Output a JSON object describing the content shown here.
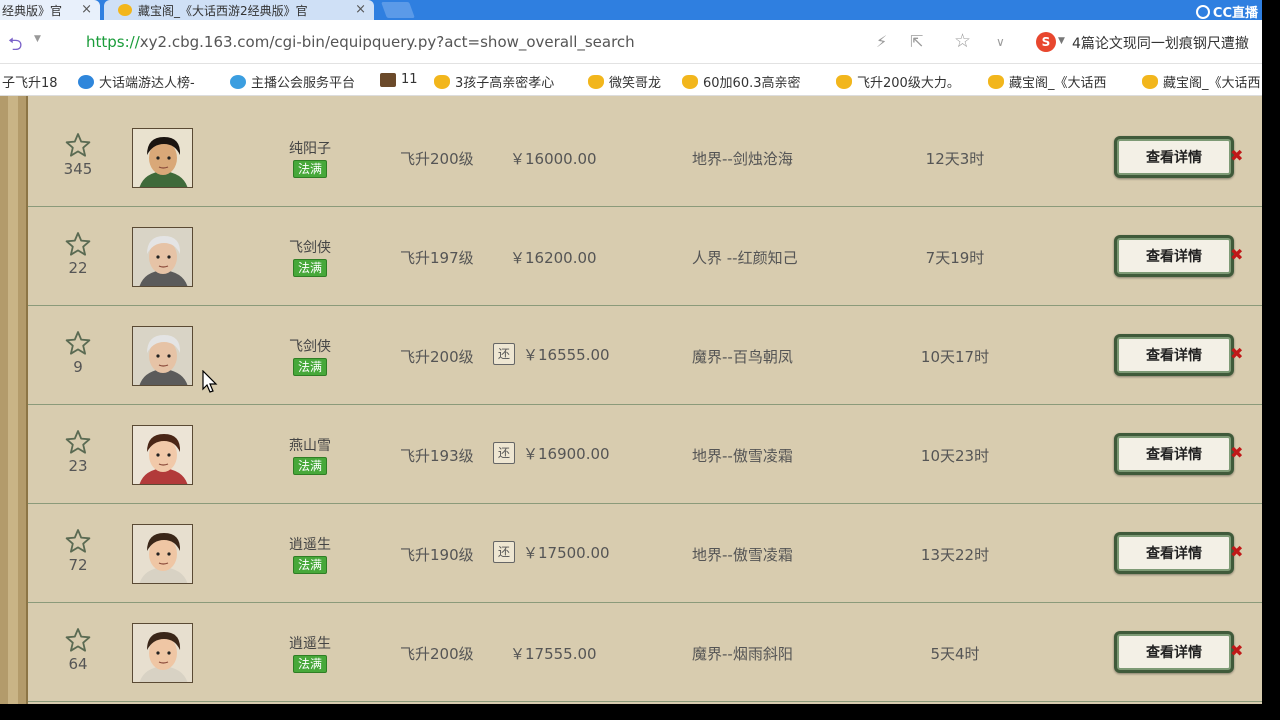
{
  "tabs": [
    {
      "label": "经典版》官",
      "close": "×"
    },
    {
      "label": "藏宝阁_《大话西游2经典版》官",
      "close": "×"
    }
  ],
  "brand": "CC直播",
  "address": {
    "scheme": "https://",
    "rest": "xy2.cbg.163.com/cgi-bin/equipquery.py?act=show_overall_search"
  },
  "search_box": {
    "text": "4篇论文现同一划痕钢尺遭撤"
  },
  "bookmarks": [
    {
      "label": "子飞升18",
      "icon": "none"
    },
    {
      "label": "大话端游达人榜-",
      "icon": "blue"
    },
    {
      "label": "主播公会服务平台",
      "icon": "globe"
    },
    {
      "label": "11",
      "icon": "game"
    },
    {
      "label": "3孩子高亲密孝心",
      "icon": "star"
    },
    {
      "label": "微笑哥龙",
      "icon": "star"
    },
    {
      "label": "60加60.3高亲密",
      "icon": "star"
    },
    {
      "label": "飞升200级大力。",
      "icon": "star"
    },
    {
      "label": "藏宝阁_《大话西",
      "icon": "star"
    },
    {
      "label": "藏宝阁_《大话西",
      "icon": "star"
    }
  ],
  "listings": [
    {
      "fav": "345",
      "avatar": "male-dark",
      "name": "纯阳子",
      "school": "法满",
      "level": "飞升200级",
      "returnable": false,
      "price": "￥16000.00",
      "server": "地界--剑烛沧海",
      "time": "12天3时",
      "button": "查看详情"
    },
    {
      "fav": "22",
      "avatar": "male-white",
      "name": "飞剑侠",
      "school": "法满",
      "level": "飞升197级",
      "returnable": false,
      "price": "￥16200.00",
      "server": "人界 --红颜知己",
      "time": "7天19时",
      "button": "查看详情"
    },
    {
      "fav": "9",
      "avatar": "male-white",
      "name": "飞剑侠",
      "school": "法满",
      "level": "飞升200级",
      "returnable": true,
      "return_label": "还",
      "price": "￥16555.00",
      "server": "魔界--百鸟朝凤",
      "time": "10天17时",
      "button": "查看详情"
    },
    {
      "fav": "23",
      "avatar": "female",
      "name": "燕山雪",
      "school": "法满",
      "level": "飞升193级",
      "returnable": true,
      "return_label": "还",
      "price": "￥16900.00",
      "server": "地界--傲雪凌霜",
      "time": "10天23时",
      "button": "查看详情"
    },
    {
      "fav": "72",
      "avatar": "male-young",
      "name": "逍遥生",
      "school": "法满",
      "level": "飞升190级",
      "returnable": true,
      "return_label": "还",
      "price": "￥17500.00",
      "server": "地界--傲雪凌霜",
      "time": "13天22时",
      "button": "查看详情"
    },
    {
      "fav": "64",
      "avatar": "male-young",
      "name": "逍遥生",
      "school": "法满",
      "level": "飞升200级",
      "returnable": false,
      "price": "￥17555.00",
      "server": "魔界--烟雨斜阳",
      "time": "5天4时",
      "button": "查看详情"
    }
  ]
}
